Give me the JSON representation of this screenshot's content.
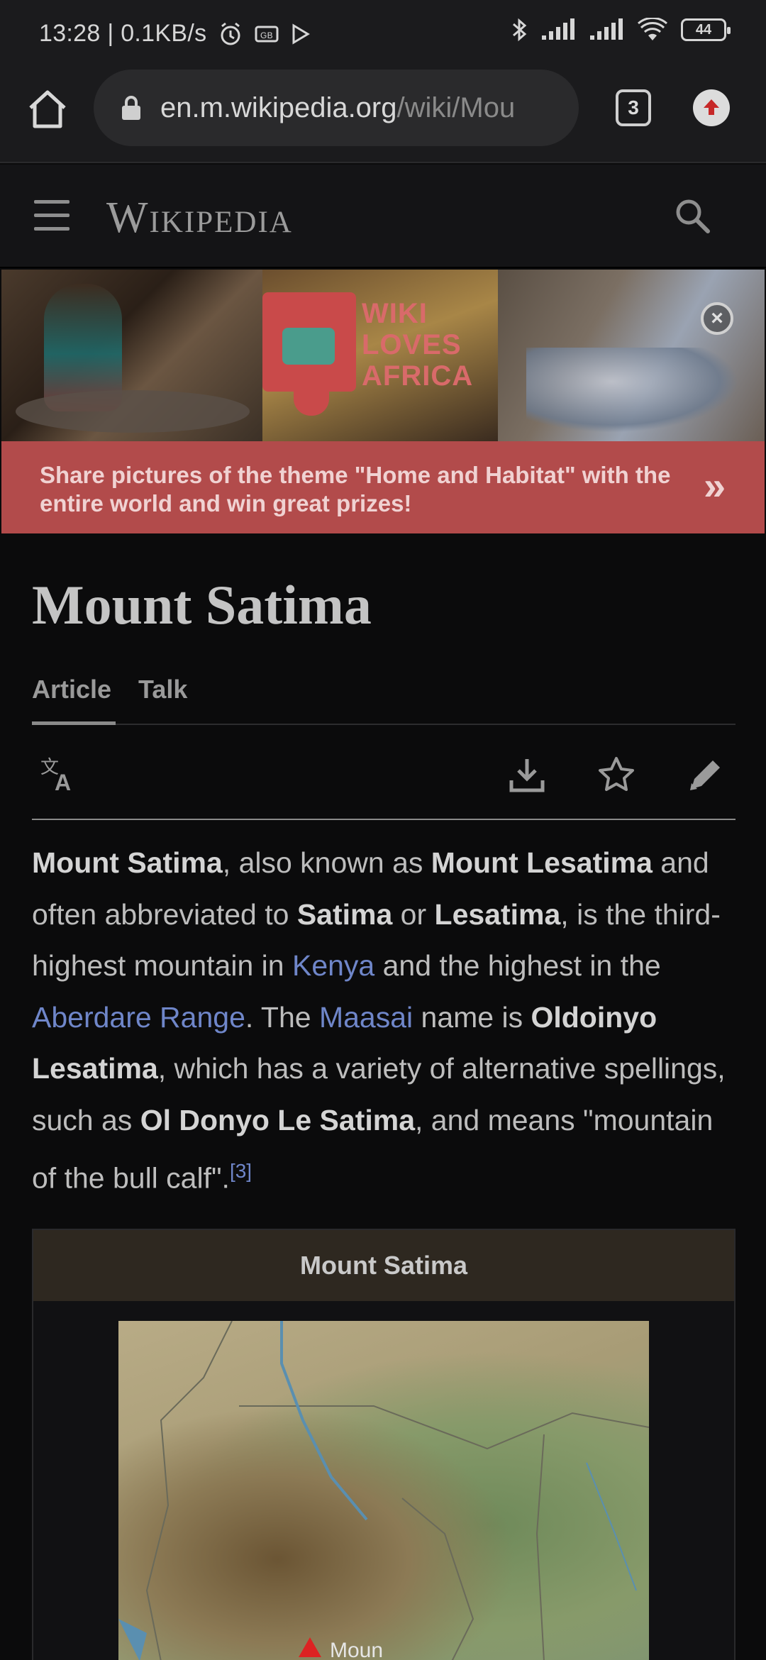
{
  "status_bar": {
    "time_speed": "13:28 | 0.1KB/s",
    "battery": "44"
  },
  "browser": {
    "url_domain": "en.m.wikipedia.org",
    "url_path": "/wiki/Mou",
    "tab_count": "3"
  },
  "wiki_header": {
    "wordmark": "Wikipedia"
  },
  "banner": {
    "logo_text": "WIKI\nLOVES\nAFRICA",
    "message": "Share pictures of the theme \"Home and Habitat\" with the entire world and win great prizes!",
    "chevron": "»",
    "close": "×"
  },
  "article": {
    "title": "Mount Satima",
    "tabs": [
      "Article",
      "Talk"
    ],
    "intro": {
      "p1": "Mount Satima",
      "t1": ", also known as ",
      "p2": "Mount Lesatima",
      "t2": " and often abbreviated to ",
      "p3": "Satima",
      "t3": " or ",
      "p4": "Lesatima",
      "t4": ", is the third-highest mountain in ",
      "l1": "Kenya",
      "t5": " and the highest in the ",
      "l2": "Aberdare Range",
      "t6": ". The ",
      "l3": "Maasai",
      "t7": " name is ",
      "p5": "Oldoinyo Lesatima",
      "t8": ", which has a variety of alternative spellings, such as ",
      "p6": "Ol Donyo Le Satima",
      "t9": ", and means \"mountain of the bull calf\".",
      "ref": "[3]"
    },
    "infobox": {
      "title": "Mount Satima",
      "map_label": "Moun"
    }
  },
  "colors": {
    "banner_bg": "#b24b4b",
    "link": "#6f86c9",
    "infobox_header": "#2e2820"
  },
  "icons": [
    "home-icon",
    "lock-icon",
    "tabs-icon",
    "update-icon",
    "menu-icon",
    "search-icon",
    "language-icon",
    "download-icon",
    "star-icon",
    "edit-icon",
    "close-icon"
  ]
}
